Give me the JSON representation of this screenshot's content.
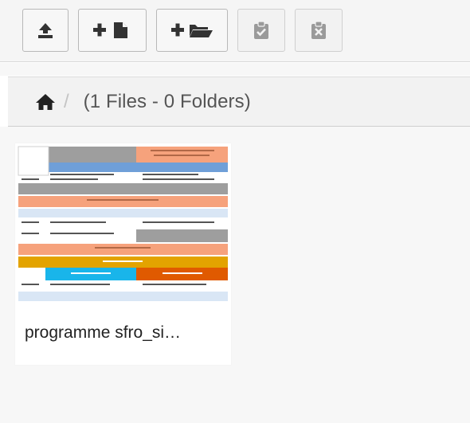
{
  "toolbar": {
    "buttons": [
      {
        "name": "upload",
        "icon": "upload-icon",
        "enabled": true
      },
      {
        "name": "new-file",
        "icon": "plus-file-icon",
        "enabled": true
      },
      {
        "name": "new-folder",
        "icon": "plus-folder-icon",
        "enabled": true
      },
      {
        "name": "paste",
        "icon": "clipboard-check-icon",
        "enabled": false
      },
      {
        "name": "clear-clipboard",
        "icon": "clipboard-x-icon",
        "enabled": false
      }
    ]
  },
  "breadcrumb": {
    "home_icon": "home-icon",
    "separator": "/",
    "count_text": "(1 Files - 0 Folders)"
  },
  "files": [
    {
      "name": "programme sfro_si…",
      "thumbnail": "document-preview"
    }
  ],
  "colors": {
    "icon": "#333333",
    "icon_disabled": "#999999",
    "thumb_orange": "#f6a27c",
    "thumb_gray": "#9e9e9e",
    "thumb_blue": "#6f9fd8",
    "thumb_amber": "#e3a300",
    "thumb_cyan": "#19b5ea",
    "thumb_deep_orange": "#e05a00"
  }
}
